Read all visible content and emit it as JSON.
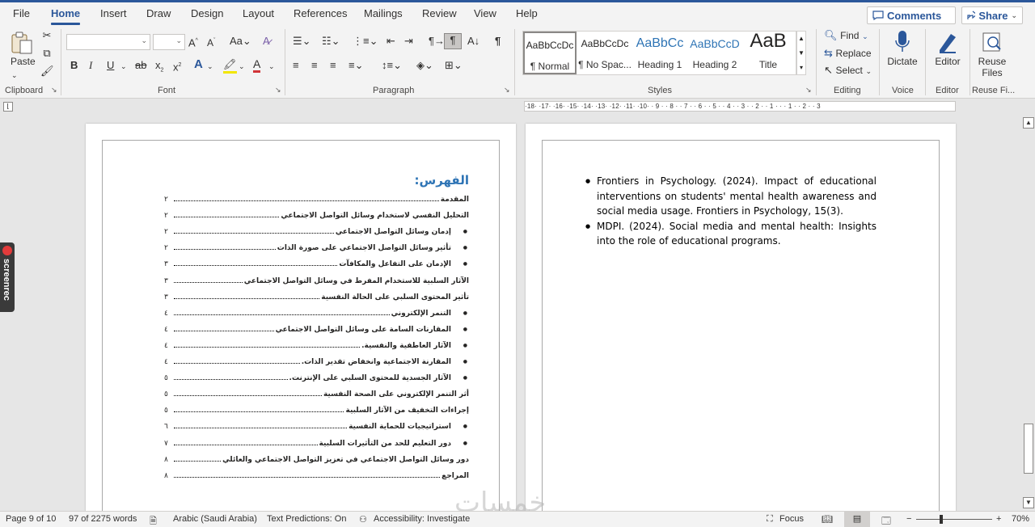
{
  "menu": {
    "tabs": [
      "File",
      "Home",
      "Insert",
      "Draw",
      "Design",
      "Layout",
      "References",
      "Mailings",
      "Review",
      "View",
      "Help"
    ],
    "active": "Home",
    "comments_label": "Comments",
    "share_label": "Share"
  },
  "ribbon": {
    "clipboard": {
      "paste": "Paste",
      "group": "Clipboard"
    },
    "font": {
      "name_value": "",
      "size_value": "",
      "group": "Font"
    },
    "paragraph": {
      "group": "Paragraph"
    },
    "styles": {
      "items": [
        {
          "preview": "AaBbCcDc",
          "name": "¶ Normal"
        },
        {
          "preview": "AaBbCcDc",
          "name": "¶ No Spac..."
        },
        {
          "preview": "AaBbCc",
          "name": "Heading 1"
        },
        {
          "preview": "AaBbCcD",
          "name": "Heading 2"
        },
        {
          "preview": "AaB",
          "name": "Title"
        }
      ],
      "group": "Styles"
    },
    "editing": {
      "find": "Find",
      "replace": "Replace",
      "select": "Select",
      "group": "Editing"
    },
    "voice": {
      "dictate": "Dictate",
      "group": "Voice"
    },
    "editor": {
      "label": "Editor",
      "group": "Editor"
    },
    "reuse": {
      "label": "Reuse Files",
      "group": "Reuse Fi..."
    }
  },
  "ruler_text": "·18· ·17· ·16· ·15· ·14· ·13· ·12· ·11· ·10· · 9 · · 8 · · 7 · · 6 · · 5 · · 4 · · 3 · · 2 · · 1 · · · 1 · · 2 · · 3",
  "toc": {
    "title": "الفهرس:",
    "rows": [
      {
        "text": "المقدمة",
        "page": "٢",
        "bullet": false
      },
      {
        "text": "التحليل النفسي لاستخدام وسائل التواصل الاجتماعي",
        "page": "٢",
        "bullet": false
      },
      {
        "text": "إدمان وسائل التواصل الاجتماعي",
        "page": "٢",
        "bullet": true
      },
      {
        "text": "تأثير وسائل التواصل الاجتماعي على صورة الذات",
        "page": "٢",
        "bullet": true
      },
      {
        "text": "الإدمان على التفاعل والمكافآت",
        "page": "٣",
        "bullet": true
      },
      {
        "text": "الآثار السلبية للاستخدام المفرط في وسائل التواصل الاجتماعي",
        "page": "٣",
        "bullet": false
      },
      {
        "text": "تأثير المحتوى السلبي على الحالة النفسية",
        "page": "٣",
        "bullet": false
      },
      {
        "text": "التنمر الإلكتروني",
        "page": "٤",
        "bullet": true
      },
      {
        "text": "المقارنات السامة على وسائل التواصل الاجتماعي",
        "page": "٤",
        "bullet": true
      },
      {
        "text": "الآثار العاطفية والنفسية.",
        "page": "٤",
        "bullet": true
      },
      {
        "text": "المقارنة الاجتماعية وانخفاض تقدير الذات.",
        "page": "٤",
        "bullet": true
      },
      {
        "text": "الآثار الجسدية للمحتوى السلبي على الإنترنت.",
        "page": "٥",
        "bullet": true
      },
      {
        "text": "أثر التنمر الإلكتروني على الصحة النفسية",
        "page": "٥",
        "bullet": false
      },
      {
        "text": "إجراءات التخفيف من الآثار السلبية",
        "page": "٥",
        "bullet": false
      },
      {
        "text": "استراتيجيات للحماية النفسية",
        "page": "٦",
        "bullet": true
      },
      {
        "text": "دور التعليم للحد من التأثيرات السلبية",
        "page": "٧",
        "bullet": true
      },
      {
        "text": "دور وسائل التواصل الاجتماعي في تعزيز التواصل الاجتماعي والعائلي",
        "page": "٨",
        "bullet": false
      },
      {
        "text": "المراجع",
        "page": "٨",
        "bullet": false
      }
    ]
  },
  "references": [
    "Frontiers in Psychology. (2024). Impact of educational interventions on students' mental health awareness and social media usage. Frontiers in Psychology, 15(3).",
    "MDPI. (2024). Social media and mental health: Insights into the role of educational programs."
  ],
  "screenrec_label": "screenrec",
  "status": {
    "page": "Page 9 of 10",
    "words": "97 of 2275 words",
    "language": "Arabic (Saudi Arabia)",
    "predictions": "Text Predictions: On",
    "accessibility": "Accessibility: Investigate",
    "focus": "Focus",
    "zoom": "70%",
    "zoom_level": 0.7
  },
  "watermark": "خمسات",
  "colors": {
    "accent": "#2b579a",
    "toc_title": "#2e74b5",
    "heading_style": "#2e74b5"
  }
}
